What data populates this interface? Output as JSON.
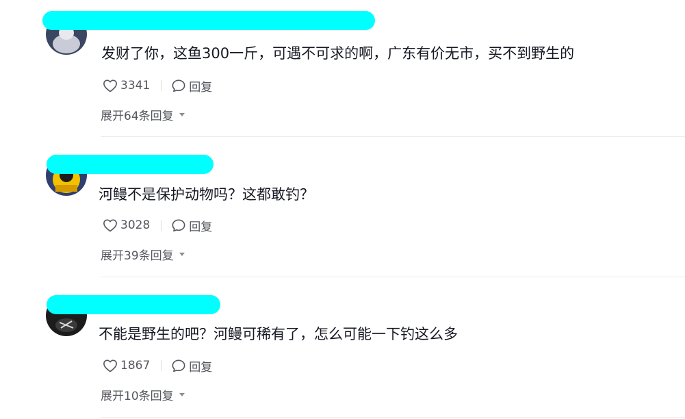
{
  "comments": [
    {
      "author": "",
      "text": "发财了你，这鱼300一斤，可遇不可求的啊，广东有价无市，买不到野生的",
      "likes": "3341",
      "reply_label": "回复",
      "expand_label": "展开64条回复"
    },
    {
      "author": "",
      "text": "河鳗不是保护动物吗？这都敢钓？",
      "likes": "3028",
      "reply_label": "回复",
      "expand_label": "展开39条回复"
    },
    {
      "author": "",
      "text": "不能是野生的吧？河鳗可稀有了，怎么可能一下钓这么多",
      "likes": "1867",
      "reply_label": "回复",
      "expand_label": "展开10条回复"
    }
  ],
  "colors": {
    "redaction": "#00ffff",
    "text_primary": "#161823",
    "text_secondary": "#55575f"
  }
}
